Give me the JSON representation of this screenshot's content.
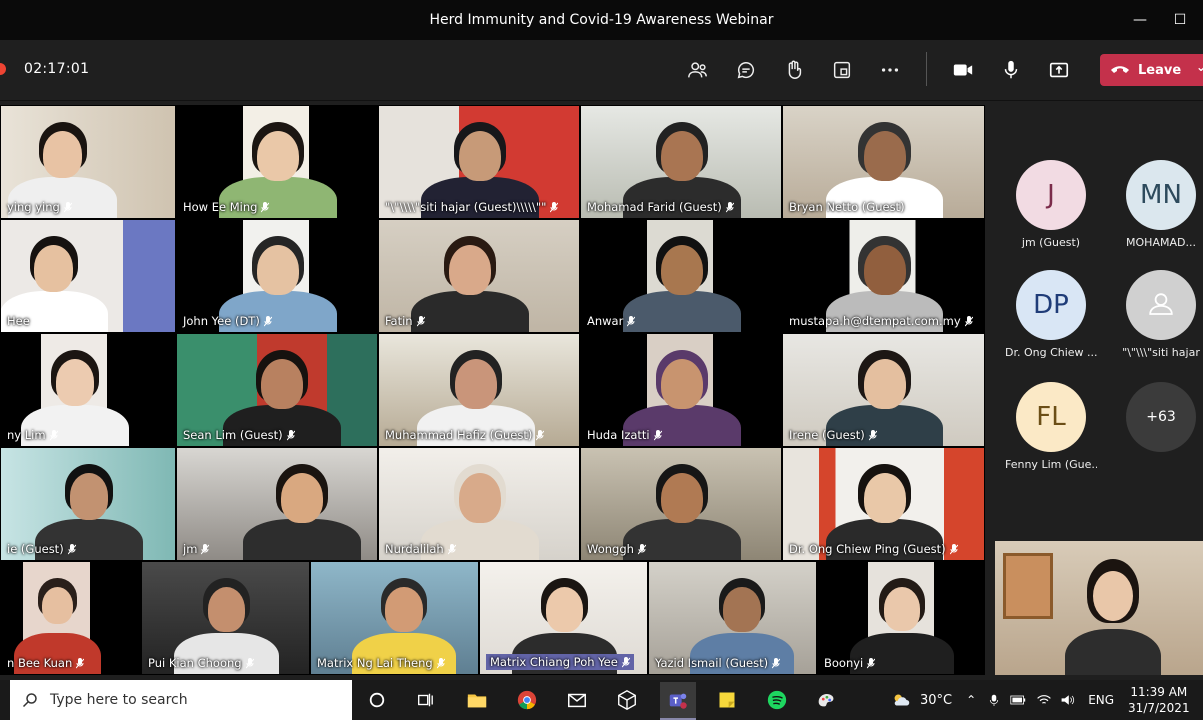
{
  "window": {
    "title": "Herd Immunity and Covid-19 Awareness Webinar"
  },
  "toolbar": {
    "timer": "02:17:01",
    "leave_label": "Leave"
  },
  "grid": {
    "tiles": [
      {
        "name": "ying ying"
      },
      {
        "name": "How Ee Ming"
      },
      {
        "name": "\"\\\"\\\\\\\\\"siti hajar (Guest)\\\\\\\\\\\"\""
      },
      {
        "name": "Mohamad Farid (Guest)"
      },
      {
        "name": "Bryan Netto (Guest)"
      },
      {
        "name": "Hee"
      },
      {
        "name": "John Yee (DT)"
      },
      {
        "name": "Fatin"
      },
      {
        "name": "Anwar"
      },
      {
        "name": "mustapa.h@dtempat.com.my"
      },
      {
        "name": "ny Lim"
      },
      {
        "name": "Sean Lim (Guest)"
      },
      {
        "name": "Muhammad Hafiz (Guest)"
      },
      {
        "name": "Huda Izatti"
      },
      {
        "name": "Irene (Guest)"
      },
      {
        "name": "ie (Guest)"
      },
      {
        "name": "jm"
      },
      {
        "name": "Nurdalilah"
      },
      {
        "name": "Wonggh"
      },
      {
        "name": "Dr. Ong Chiew Ping (Guest)"
      },
      {
        "name": "n Bee Kuan"
      },
      {
        "name": "Pui Kian Choong"
      },
      {
        "name": "Matrix Ng Lai Theng"
      },
      {
        "name": "Matrix Chiang Poh Yee"
      },
      {
        "name": "Yazid Ismail (Guest)"
      },
      {
        "name": "Boonyi"
      }
    ]
  },
  "roster": [
    {
      "initials": "J",
      "name": "jm (Guest)",
      "bg": "#f2dbe3",
      "fg": "#7b2b4a"
    },
    {
      "initials": "MN",
      "name": "MOHAMAD...",
      "bg": "#dbe7ee",
      "fg": "#2d4a5c"
    },
    {
      "initials": "DP",
      "name": "Dr. Ong Chiew ...",
      "bg": "#d9e6f5",
      "fg": "#1f3c78"
    },
    {
      "initials": "",
      "name": "\"\\\"\\\\\\\"siti hajar",
      "bg": "#d0d0d0",
      "fg": "#fff"
    },
    {
      "initials": "FL",
      "name": "Fenny Lim (Gue...",
      "bg": "#fbe9c6",
      "fg": "#6b4e16"
    },
    {
      "initials": "+63",
      "name": "",
      "bg": "#3b3b3b",
      "fg": "#fff"
    }
  ],
  "taskbar": {
    "search_placeholder": "Type here to search",
    "weather": "30°C",
    "lang": "ENG",
    "time": "11:39 AM",
    "date": "31/7/2021"
  },
  "colors": {
    "accent": "#6264a7",
    "leave": "#c4314b"
  }
}
